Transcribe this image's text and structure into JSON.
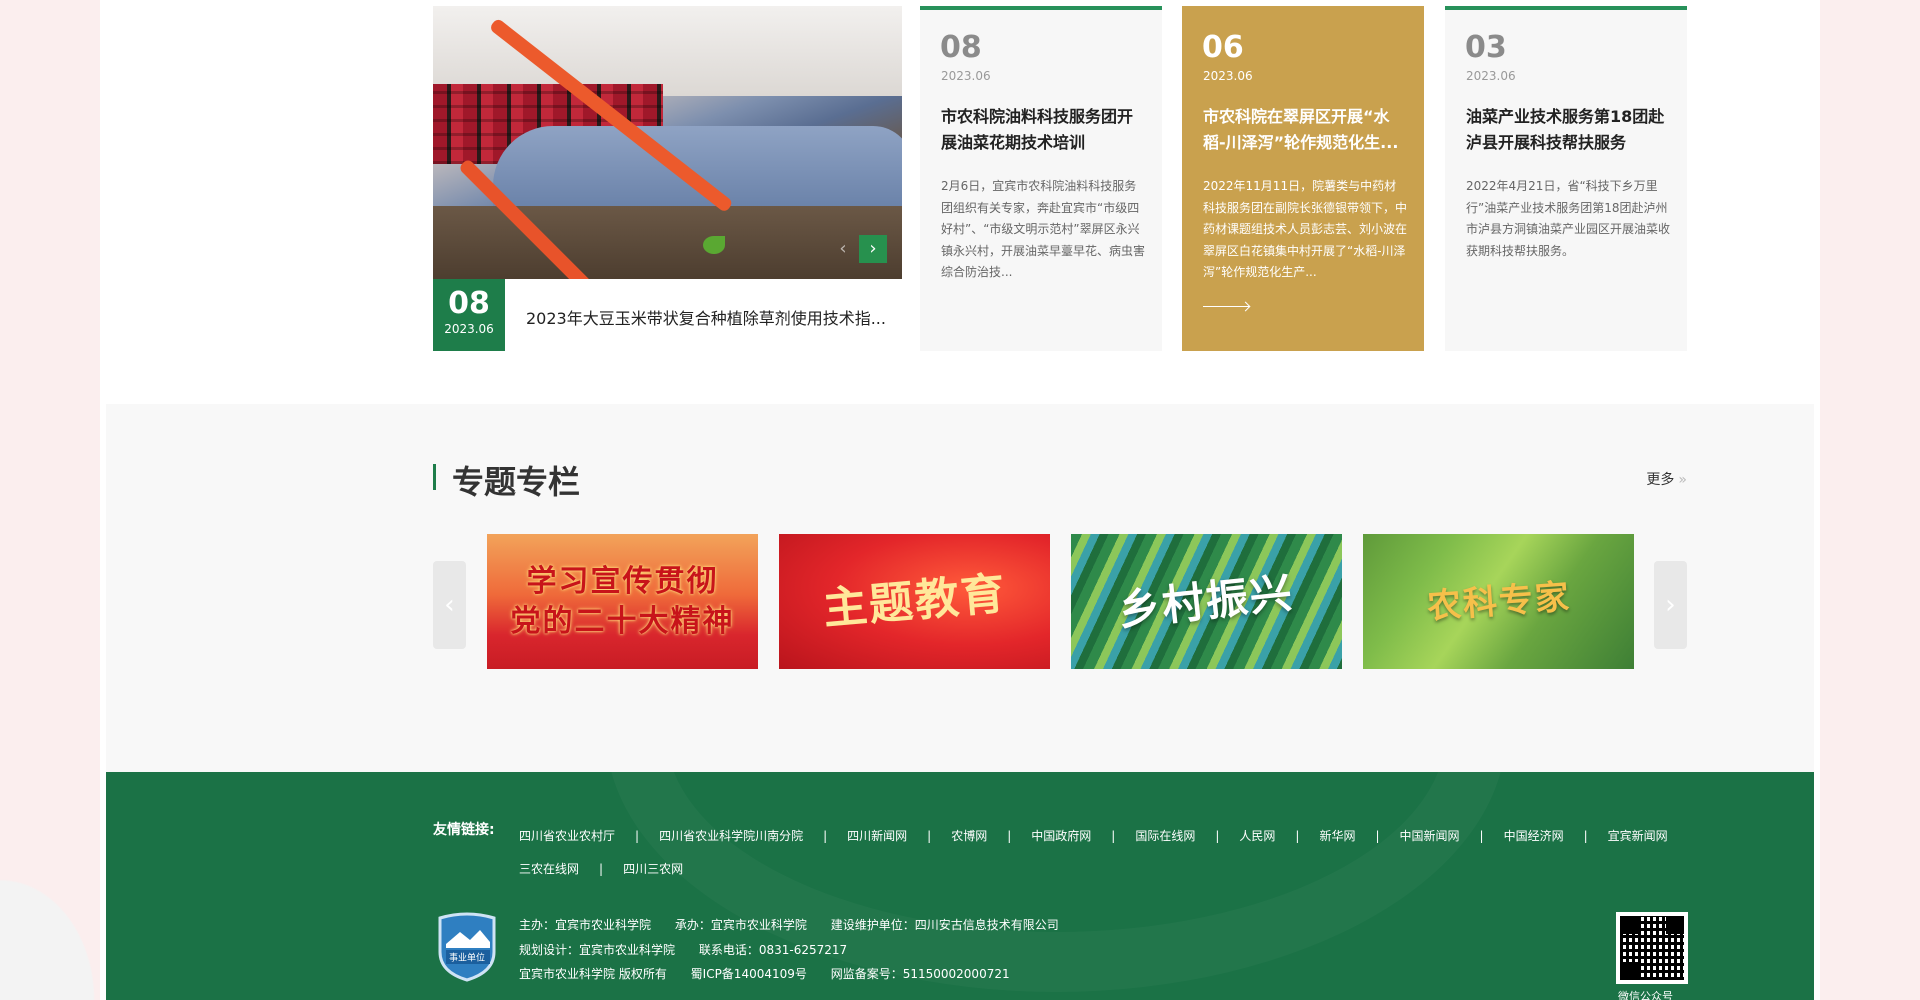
{
  "news": {
    "feature": {
      "day": "08",
      "ym": "2023.06",
      "title": "2023年大豆玉米带状复合种植除草剂使用技术指..."
    },
    "cards": [
      {
        "day": "08",
        "ym": "2023.06",
        "title": "市农科院油料科技服务团开展油菜花期技术培训",
        "desc": "2月6日，宜宾市农科院油料科技服务团组织有关专家，奔赴宜宾市“市级四好村”、“市级文明示范村”翠屏区永兴镇永兴村，开展油菜早薹早花、病虫害综合防治技..."
      },
      {
        "day": "06",
        "ym": "2023.06",
        "title": "市农科院在翠屏区开展“水稻-川泽泻”轮作规范化生...",
        "desc": "2022年11月11日，院薯类与中药材科技服务团在副院长张德银带领下，中药材课题组技术人员彭志芸、刘小波在翠屏区白花镇集中村开展了“水稻-川泽泻”轮作规范化生产..."
      },
      {
        "day": "03",
        "ym": "2023.06",
        "title": "油菜产业技术服务第18团赴泸县开展科技帮扶服务",
        "desc": "2022年4月21日，省“科技下乡万里行”油菜产业技术服务团第18团赴泸州市泸县方洞镇油菜产业园区开展油菜收获期科技帮扶服务。"
      }
    ]
  },
  "topics": {
    "title": "专题专栏",
    "more": "更多",
    "more_icon": "»",
    "prev_icon": "‹",
    "next_icon": "›",
    "banners": [
      {
        "text": "学习宣传贯彻\n党的二十大精神"
      },
      {
        "text": "主题教育"
      },
      {
        "text": "乡村振兴"
      },
      {
        "text": "农科专家"
      }
    ]
  },
  "footer": {
    "links_label": "友情链接:",
    "links": [
      "四川省农业农村厅",
      "四川省农业科学院川南分院",
      "四川新闻网",
      "农博网",
      "中国政府网",
      "国际在线网",
      "人民网",
      "新华网",
      "中国新闻网",
      "中国经济网",
      "宜宾新闻网",
      "三农在线网",
      "四川三农网"
    ],
    "info": {
      "host": "主办：宜宾市农业科学院",
      "organizer": "承办：宜宾市农业科学院",
      "maintainer": "建设维护单位：四川安古信息技术有限公司",
      "design": "规划设计：宜宾市农业科学院",
      "phone": "联系电话：0831-6257217",
      "copyright": "宜宾市农业科学院 版权所有",
      "icp": "蜀ICP备14004109号",
      "police": "网监备案号：51150002000721"
    },
    "logo_text": "事业单位",
    "qr_label": "微信公众号"
  },
  "colors": {
    "brand_green": "#1e7d4a",
    "accent_gold": "#c9a14e",
    "footer_green": "#1b7246"
  }
}
